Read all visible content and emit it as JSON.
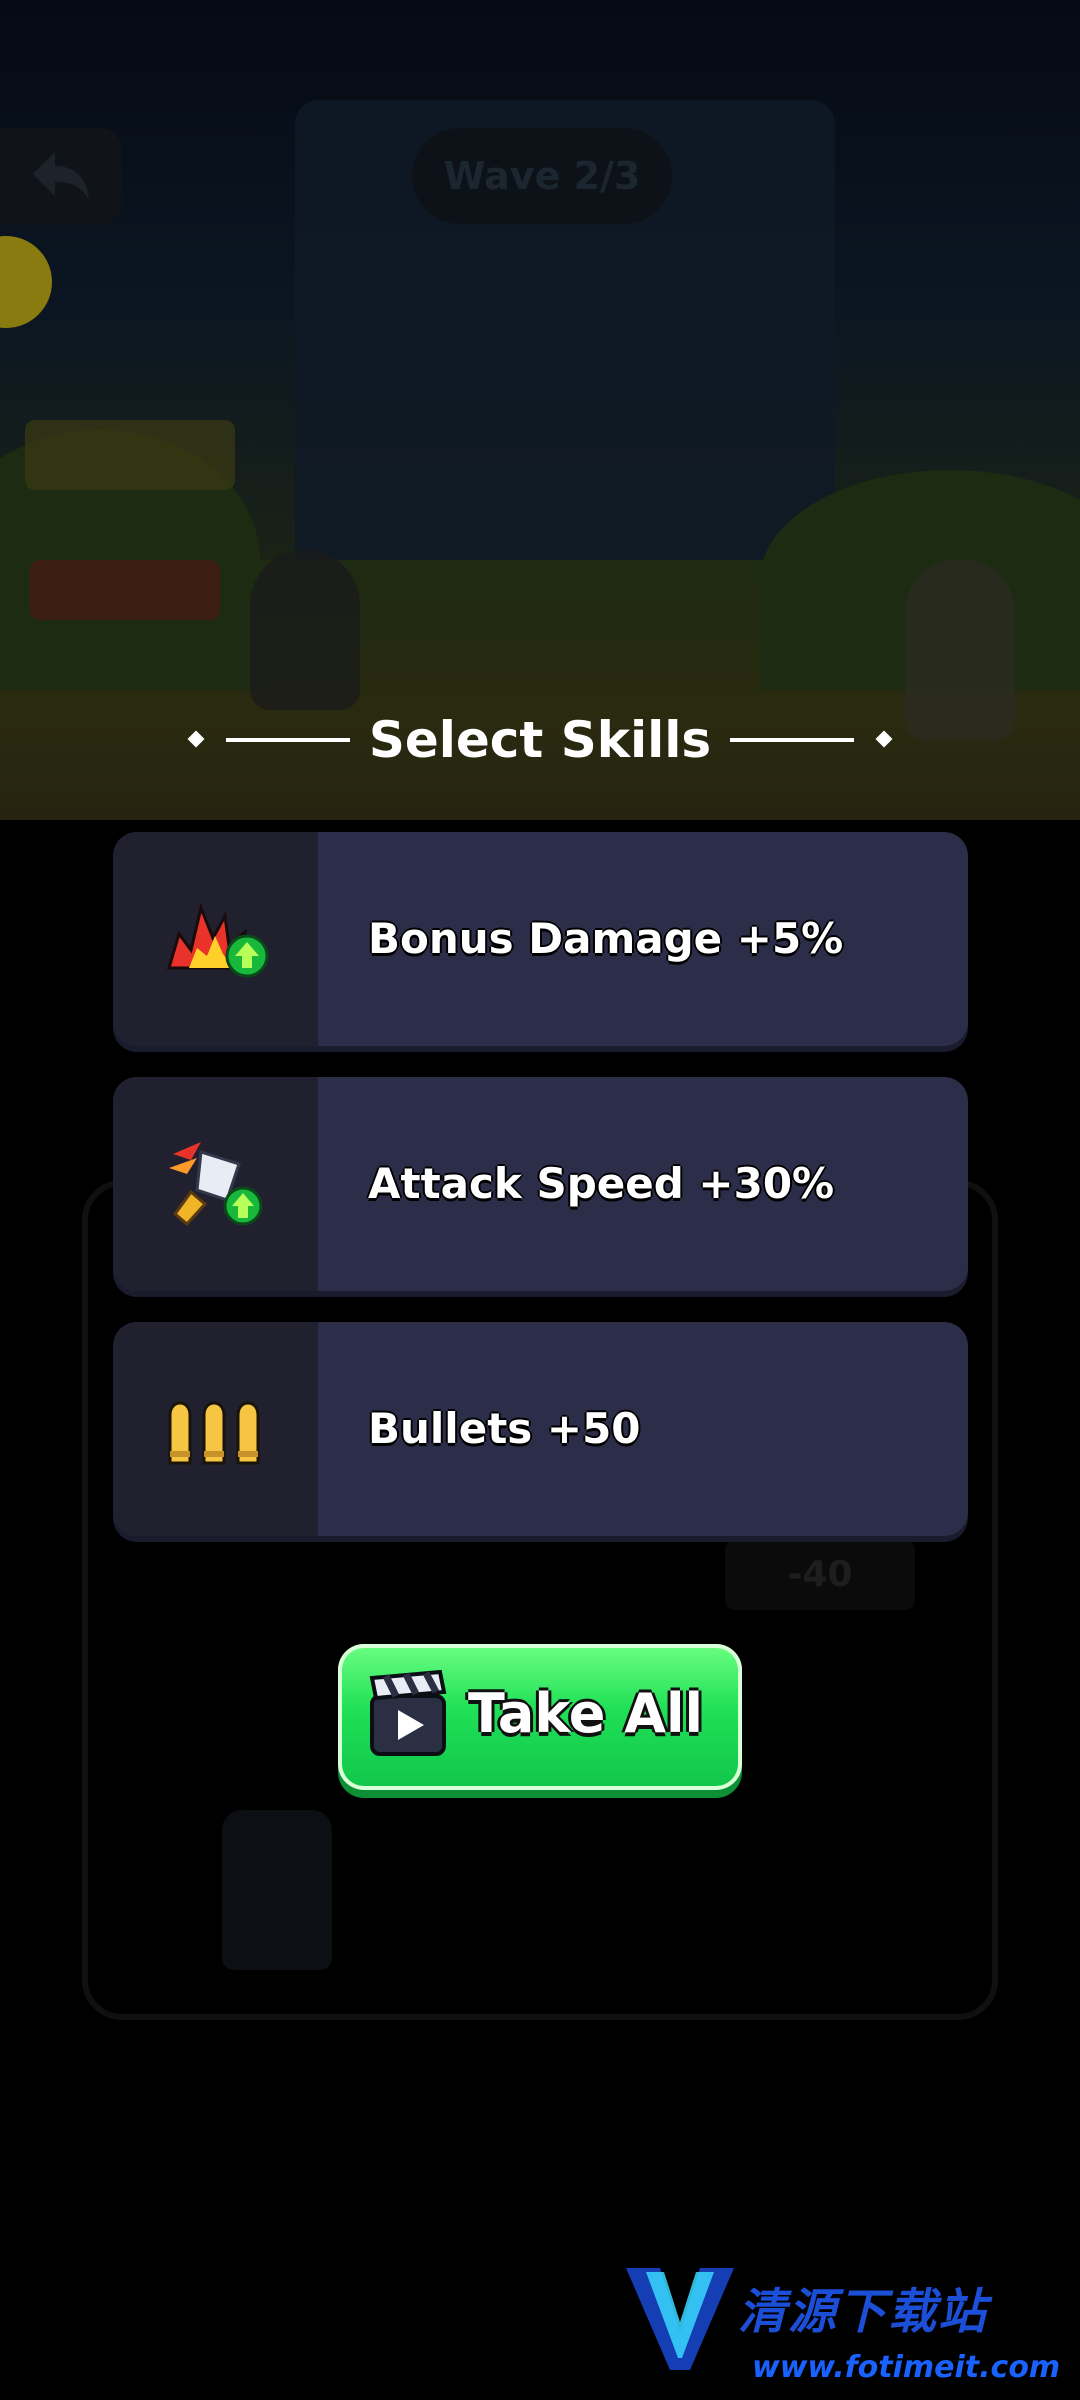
{
  "hud": {
    "back_icon": "back-arrow-icon",
    "wave_label": "Wave 2/3"
  },
  "dialog": {
    "title": "Select Skills",
    "skills": [
      {
        "label": "Bonus Damage +5%",
        "icon": "explosion-up-icon"
      },
      {
        "label": "Attack Speed +30%",
        "icon": "sword-speed-up-icon"
      },
      {
        "label": "Bullets +50",
        "icon": "bullets-icon"
      }
    ],
    "take_all": {
      "label": "Take All",
      "icon": "video-clapper-icon"
    }
  },
  "background": {
    "meter_text": "-40"
  },
  "watermark": {
    "name": "清源下载站",
    "url": "www.fotimeit.com"
  },
  "colors": {
    "card_bg": "#2c2d48",
    "card_icon_bg": "#20202f",
    "button_green": "#1fe056",
    "text": "#ffffff"
  }
}
